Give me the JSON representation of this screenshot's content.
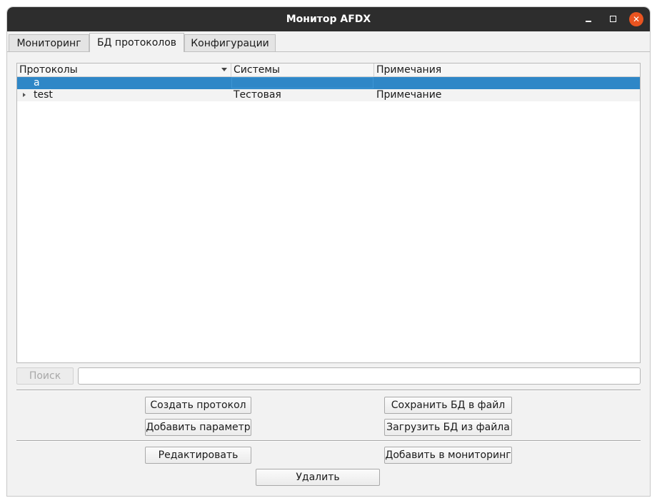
{
  "window": {
    "title": "Монитор AFDX",
    "controls": {
      "minimize": "",
      "maximize": "",
      "close": "✕"
    }
  },
  "tabs": [
    {
      "label": "Мониторинг",
      "active": false
    },
    {
      "label": "БД протоколов",
      "active": true
    },
    {
      "label": "Конфигурации",
      "active": false
    }
  ],
  "tree": {
    "columns": [
      "Протоколы",
      "Системы",
      "Примечания"
    ],
    "sort_column": "Протоколы",
    "rows": [
      {
        "protocol": "a",
        "system": "",
        "note": "",
        "selected": true,
        "expandable": false
      },
      {
        "protocol": "test",
        "system": "Тестовая",
        "note": "Примечание",
        "selected": false,
        "expandable": true
      }
    ]
  },
  "search": {
    "button_label": "Поиск",
    "button_enabled": false,
    "value": "",
    "placeholder": ""
  },
  "actions": {
    "create_protocol": "Создать протокол",
    "add_parameter": "Добавить параметр",
    "save_db": "Сохранить БД в файл",
    "load_db": "Загрузить БД из файла",
    "edit": "Редактировать",
    "add_to_monitoring": "Добавить в мониторинг",
    "delete": "Удалить"
  },
  "colors": {
    "titlebar": "#2d2d2d",
    "close_button": "#e95420",
    "selection": "#2f87c7",
    "window_bg": "#f2f2f2"
  }
}
